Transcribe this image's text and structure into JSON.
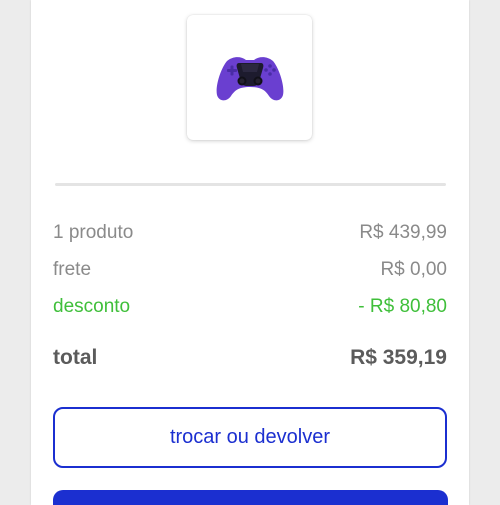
{
  "product": {
    "image_icon": "gamepad-controller-icon"
  },
  "summary": {
    "products_label": "1 produto",
    "products_value": "R$ 439,99",
    "shipping_label": "frete",
    "shipping_value": "R$ 0,00",
    "discount_label": "desconto",
    "discount_value": "- R$ 80,80",
    "total_label": "total",
    "total_value": "R$ 359,19"
  },
  "actions": {
    "exchange_return_label": "trocar ou devolver"
  },
  "colors": {
    "primary": "#1b2fd0",
    "discount": "#3fbf3a",
    "controller": "#6a3fd0"
  }
}
